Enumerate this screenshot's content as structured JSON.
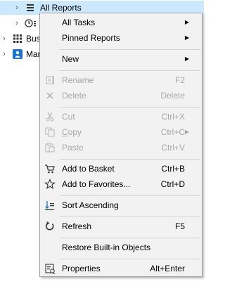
{
  "tree": {
    "rows": [
      {
        "label": "All Reports",
        "icon": "list-icon",
        "selected": true
      },
      {
        "label": "",
        "icon": "clock-list-icon",
        "selected": false
      },
      {
        "label": "Busi",
        "icon": "grid-icon",
        "selected": false
      },
      {
        "label": "Mar",
        "icon": "person-badge-icon",
        "selected": false
      }
    ]
  },
  "menu": {
    "items": [
      {
        "label": "All Tasks",
        "shortcut": "",
        "submenu": true,
        "disabled": false,
        "icon": ""
      },
      {
        "label": "Pinned Reports",
        "shortcut": "",
        "submenu": true,
        "disabled": false,
        "icon": ""
      },
      {
        "label": "New",
        "shortcut": "",
        "submenu": true,
        "disabled": false,
        "icon": ""
      },
      {
        "label": "Rename",
        "shortcut": "F2",
        "submenu": false,
        "disabled": true,
        "icon": "rename-icon"
      },
      {
        "label": "Delete",
        "shortcut": "Delete",
        "submenu": false,
        "disabled": true,
        "icon": "delete-x-icon"
      },
      {
        "label": "Cut",
        "shortcut": "Ctrl+X",
        "submenu": false,
        "disabled": true,
        "icon": "scissors-icon"
      },
      {
        "label": "Copy",
        "shortcut": "Ctrl+C",
        "submenu": true,
        "disabled": true,
        "icon": "copy-icon"
      },
      {
        "label": "Paste",
        "shortcut": "Ctrl+V",
        "submenu": false,
        "disabled": true,
        "icon": "paste-icon"
      },
      {
        "label": "Add to Basket",
        "shortcut": "Ctrl+B",
        "submenu": false,
        "disabled": false,
        "icon": "cart-icon"
      },
      {
        "label": "Add to Favorites...",
        "shortcut": "Ctrl+D",
        "submenu": false,
        "disabled": false,
        "icon": "star-icon"
      },
      {
        "label": "Sort Ascending",
        "shortcut": "",
        "submenu": false,
        "disabled": false,
        "icon": "sort-ascending-icon"
      },
      {
        "label": "Refresh",
        "shortcut": "F5",
        "submenu": false,
        "disabled": false,
        "icon": "refresh-icon"
      },
      {
        "label": "Restore Built-in Objects",
        "shortcut": "",
        "submenu": false,
        "disabled": false,
        "icon": ""
      },
      {
        "label": "Properties",
        "shortcut": "Alt+Enter",
        "submenu": false,
        "disabled": false,
        "icon": "properties-icon"
      }
    ]
  },
  "colors": {
    "selection": "#cce8ff",
    "menu_bg": "#f2f2f2",
    "disabled_text": "#a6a6a6",
    "accent": "#1a73c8"
  }
}
